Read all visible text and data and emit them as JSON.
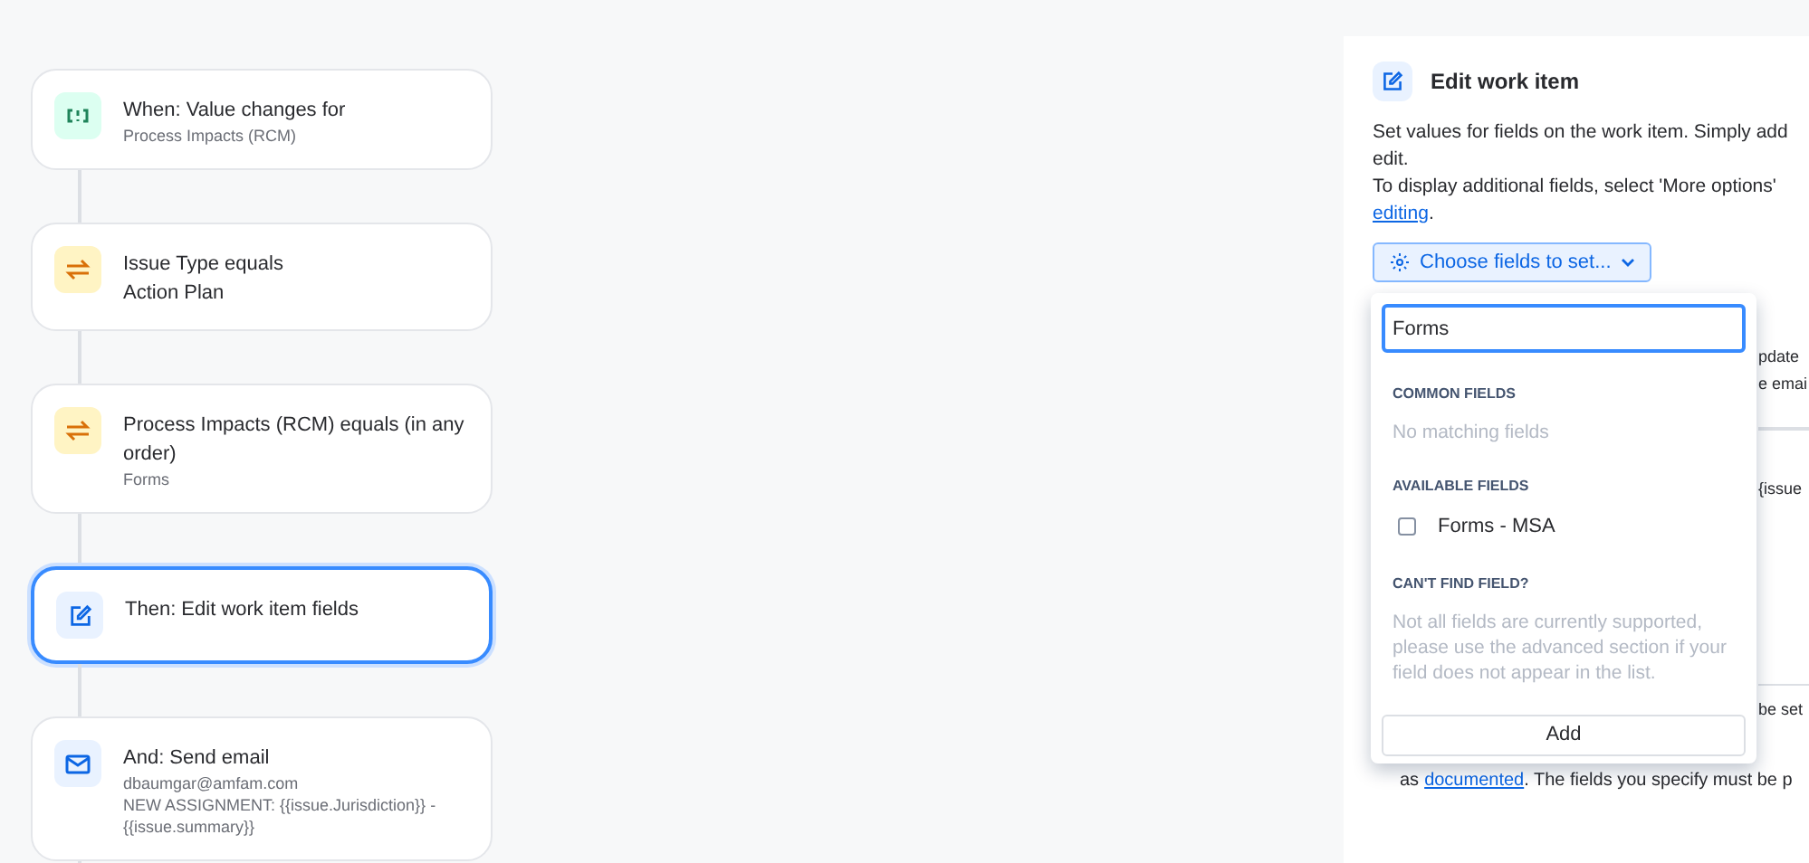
{
  "flow": {
    "nodes": [
      {
        "kind": "trigger",
        "selected": false,
        "lines": [
          {
            "text": "When: Value changes for",
            "kind": "title"
          },
          {
            "text": "Process Impacts (RCM)",
            "kind": "meta"
          }
        ]
      },
      {
        "kind": "condition",
        "selected": false,
        "lines": [
          {
            "text": "Issue Type equals",
            "kind": "title"
          },
          {
            "text": "Action Plan",
            "kind": "title"
          }
        ]
      },
      {
        "kind": "condition",
        "selected": false,
        "lines": [
          {
            "text": "Process Impacts (RCM) equals (in any order)",
            "kind": "title"
          },
          {
            "text": "Forms",
            "kind": "meta"
          }
        ]
      },
      {
        "kind": "edit",
        "selected": true,
        "lines": [
          {
            "text": "Then: Edit work item fields",
            "kind": "title"
          }
        ]
      },
      {
        "kind": "email",
        "selected": false,
        "lines": [
          {
            "text": "And: Send email",
            "kind": "title"
          },
          {
            "text": "dbaumgar@amfam.com",
            "kind": "meta"
          },
          {
            "text": "NEW ASSIGNMENT: {{issue.Jurisdiction}} - {{issue.summary}}",
            "kind": "meta"
          }
        ]
      }
    ]
  },
  "panel": {
    "title": "Edit work item",
    "description": [
      "Set values for fields on the work item. Simply add",
      "edit.",
      "To display additional fields, select 'More options'"
    ],
    "link": "editing",
    "link_suffix": ".",
    "choose_button": "Choose fields to set...",
    "covered_fragments": [
      "pdate",
      "e emai",
      "{issue",
      "be set"
    ],
    "footer_prefix": "as ",
    "footer_link": "documented",
    "footer_suffix": ". The fields you specify must be p"
  },
  "dropdown": {
    "search": {
      "value": "Forms"
    },
    "sections": [
      {
        "heading": "COMMON FIELDS",
        "kind": "empty",
        "text": "No matching fields"
      },
      {
        "heading": "AVAILABLE FIELDS",
        "kind": "options",
        "options": [
          {
            "label": "Forms - MSA",
            "checked": false
          }
        ]
      },
      {
        "heading": "CAN'T FIND FIELD?",
        "kind": "empty",
        "text": "Not all fields are currently supported, please use the advanced section if your field does not appear in the list."
      }
    ],
    "add_button": "Add"
  }
}
